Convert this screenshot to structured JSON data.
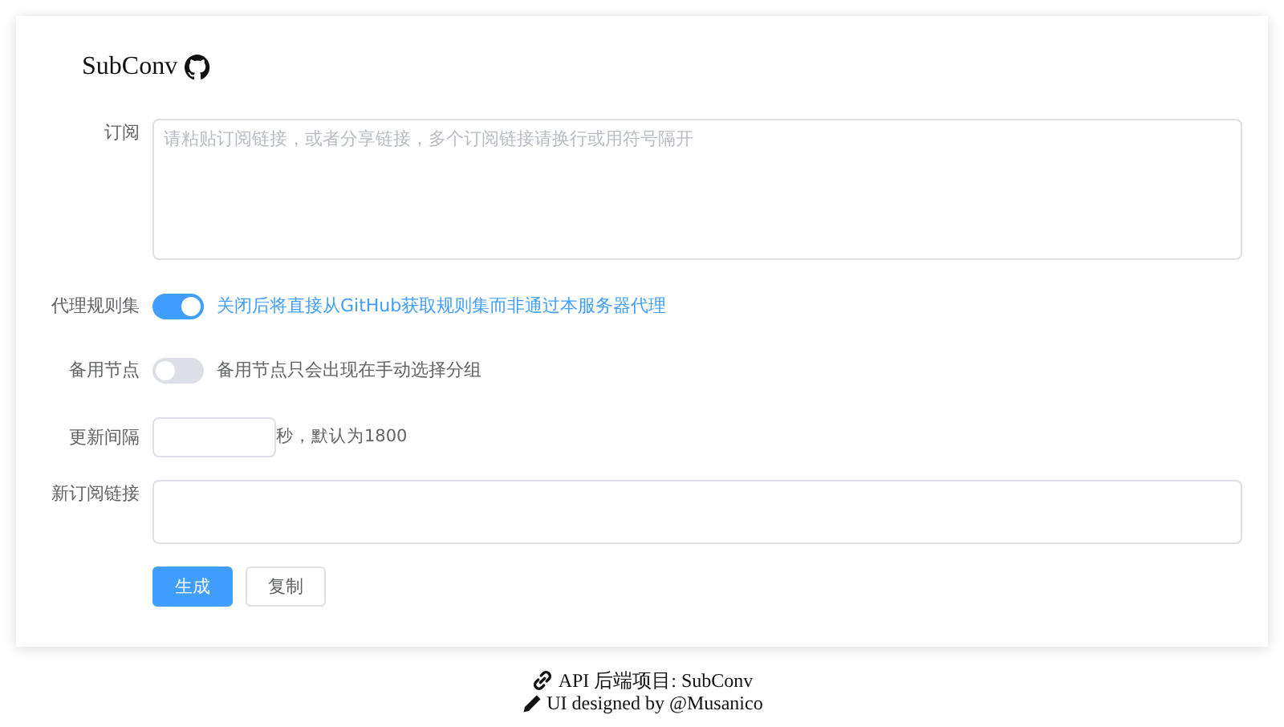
{
  "header": {
    "title": "SubConv"
  },
  "form": {
    "subscription": {
      "label": "订阅",
      "placeholder": "请粘贴订阅链接，或者分享链接，多个订阅链接请换行或用符号隔开"
    },
    "switches": [
      {
        "label": "代理规则集",
        "on": true,
        "hint": "关闭后将直接从GitHub获取规则集而非通过本服务器代理"
      },
      {
        "label": "备用节点",
        "on": false,
        "hint": "备用节点只会出现在手动选择分组"
      }
    ],
    "interval": {
      "label": "更新间隔",
      "suffix": "秒，默认为1800"
    },
    "new_link": {
      "label": "新订阅链接"
    },
    "buttons": [
      {
        "label": "生成",
        "kind": "primary"
      },
      {
        "label": "复制",
        "kind": "default"
      }
    ]
  },
  "footer": [
    {
      "text": "API 后端项目: SubConv",
      "kind": "link"
    },
    {
      "text": "UI designed by @Musanico",
      "kind": "pencil"
    }
  ]
}
